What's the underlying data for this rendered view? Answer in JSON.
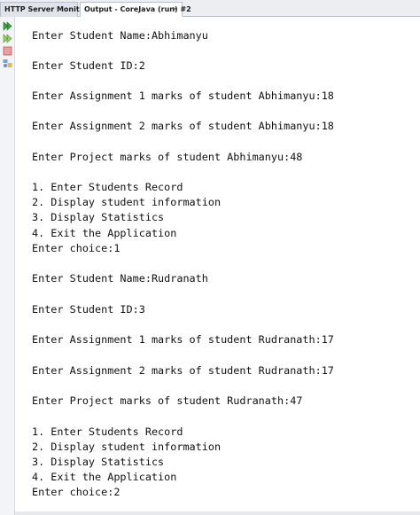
{
  "tabs": [
    {
      "label": "HTTP Server Monitor"
    },
    {
      "label": "Output - CoreJava (run) #2",
      "close": "✕"
    }
  ],
  "toolbar": {
    "icons": [
      "rerun-icon",
      "rerun-with-options-icon",
      "stop-icon",
      "settings-icon"
    ],
    "colors": {
      "rerun": "#3aa33a",
      "stop": "#d23b3b"
    }
  },
  "console": {
    "lines": [
      "Enter Student Name:Abhimanyu",
      "",
      "Enter Student ID:2",
      "",
      "Enter Assignment 1 marks of student Abhimanyu:18",
      "",
      "Enter Assignment 2 marks of student Abhimanyu:18",
      "",
      "Enter Project marks of student Abhimanyu:48",
      "",
      "1. Enter Students Record",
      "2. Display student information",
      "3. Display Statistics",
      "4. Exit the Application",
      "Enter choice:1",
      "",
      "Enter Student Name:Rudranath",
      "",
      "Enter Student ID:3",
      "",
      "Enter Assignment 1 marks of student Rudranath:17",
      "",
      "Enter Assignment 2 marks of student Rudranath:17",
      "",
      "Enter Project marks of student Rudranath:47",
      "",
      "1. Enter Students Record",
      "2. Display student information",
      "3. Display Statistics",
      "4. Exit the Application",
      "Enter choice:2"
    ]
  }
}
